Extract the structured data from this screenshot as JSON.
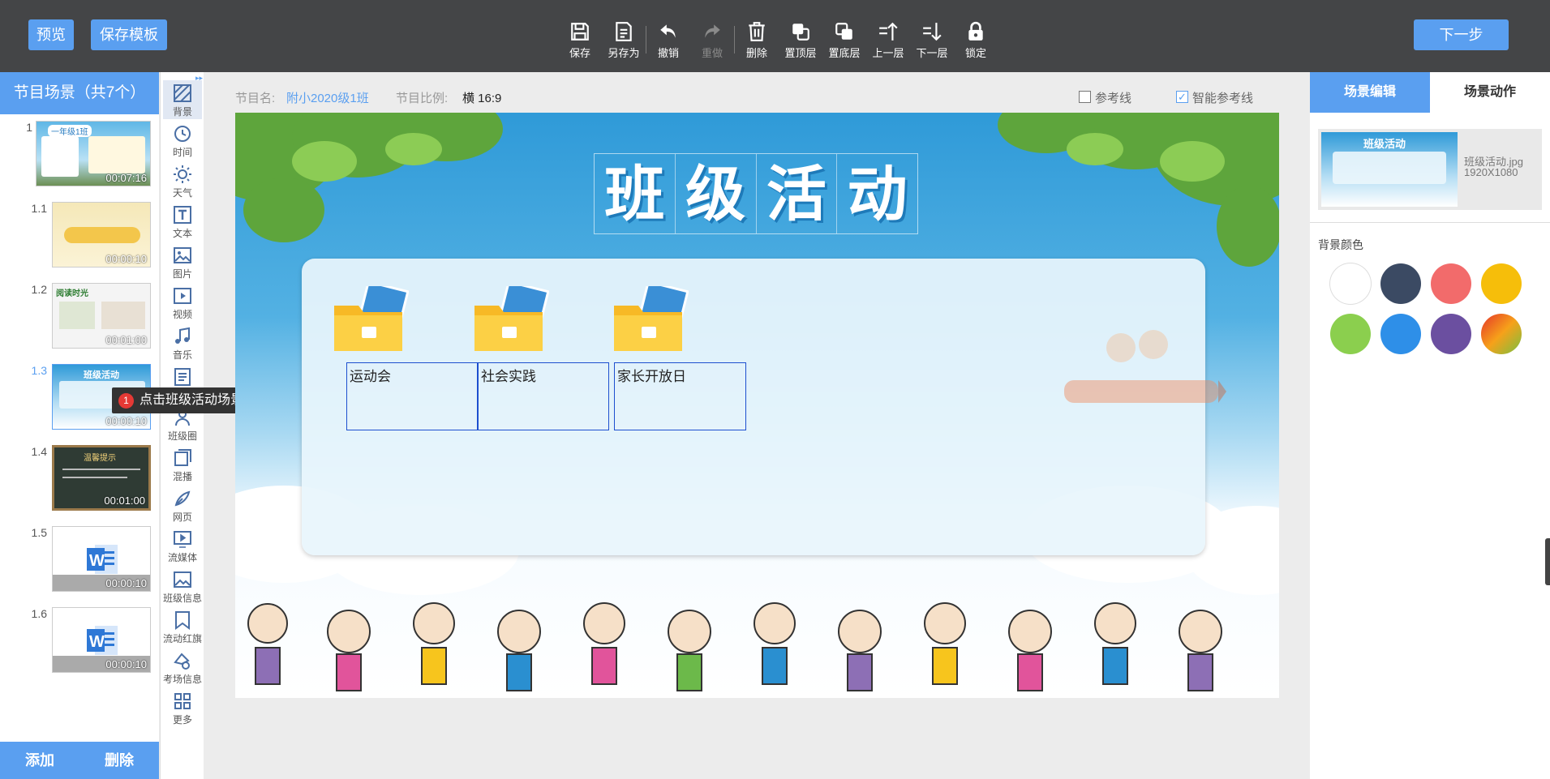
{
  "header": {
    "preview_label": "预览",
    "save_template_label": "保存模板",
    "next_label": "下一步",
    "tools": [
      {
        "label": "保存",
        "icon": "save-icon",
        "enabled": true
      },
      {
        "label": "另存为",
        "icon": "save-as-icon",
        "enabled": true
      },
      {
        "label": "撤销",
        "icon": "undo-icon",
        "enabled": true
      },
      {
        "label": "重做",
        "icon": "redo-icon",
        "enabled": false
      },
      {
        "label": "删除",
        "icon": "trash-icon",
        "enabled": true
      },
      {
        "label": "置顶层",
        "icon": "bring-to-front-icon",
        "enabled": true
      },
      {
        "label": "置底层",
        "icon": "send-to-back-icon",
        "enabled": true
      },
      {
        "label": "上一层",
        "icon": "layer-up-icon",
        "enabled": true
      },
      {
        "label": "下一层",
        "icon": "layer-down-icon",
        "enabled": true
      },
      {
        "label": "锁定",
        "icon": "lock-icon",
        "enabled": true
      }
    ]
  },
  "left_panel": {
    "title": "节目场景（共7个）",
    "scenes": [
      {
        "number": "1",
        "duration": "00:07:16",
        "active": false
      },
      {
        "number": "1.1",
        "duration": "00:00:10",
        "active": false
      },
      {
        "number": "1.2",
        "duration": "00:01:00",
        "active": false
      },
      {
        "number": "1.3",
        "duration": "00:00:10",
        "active": true
      },
      {
        "number": "1.4",
        "duration": "00:01:00",
        "active": false
      },
      {
        "number": "1.5",
        "duration": "00:00:10",
        "active": false
      },
      {
        "number": "1.6",
        "duration": "00:00:10",
        "active": false
      }
    ],
    "add_label": "添加",
    "delete_label": "删除",
    "thumb_texts": {
      "t1": "一年级1班",
      "t2": "阅读时光",
      "t3": "班级活动",
      "t4": "温馨提示"
    }
  },
  "tools_bar": [
    {
      "label": "背景",
      "icon": "background-icon"
    },
    {
      "label": "时间",
      "icon": "clock-icon"
    },
    {
      "label": "天气",
      "icon": "weather-icon"
    },
    {
      "label": "文本",
      "icon": "text-icon"
    },
    {
      "label": "图片",
      "icon": "image-icon"
    },
    {
      "label": "视频",
      "icon": "video-icon"
    },
    {
      "label": "音乐",
      "icon": "music-icon"
    },
    {
      "label": "文档",
      "icon": "document-icon"
    },
    {
      "label": "班级圈",
      "icon": "class-circle-icon"
    },
    {
      "label": "混播",
      "icon": "mixed-play-icon"
    },
    {
      "label": "网页",
      "icon": "webpage-icon"
    },
    {
      "label": "流媒体",
      "icon": "stream-icon"
    },
    {
      "label": "班级信息",
      "icon": "class-info-icon"
    },
    {
      "label": "流动红旗",
      "icon": "red-flag-icon"
    },
    {
      "label": "考场信息",
      "icon": "exam-info-icon"
    },
    {
      "label": "更多",
      "icon": "more-grid-icon"
    }
  ],
  "tooltip": {
    "number": "1",
    "text": "点击班级活动场景"
  },
  "info_bar": {
    "program_name_label": "节目名:",
    "program_name_value": "附小2020级1班",
    "ratio_label": "节目比例:",
    "ratio_value": "横 16:9",
    "guide_label": "参考线",
    "smart_guide_label": "智能参考线",
    "guide_checked": false,
    "smart_guide_checked": true
  },
  "canvas": {
    "title_chars": [
      "班",
      "级",
      "活",
      "动"
    ],
    "folders": [
      "运动会",
      "社会实践",
      "家长开放日"
    ]
  },
  "right_panel": {
    "tab_scene_edit": "场景编辑",
    "tab_scene_action": "场景动作",
    "bg_filename": "班级活动.jpg",
    "bg_size": "1920X1080",
    "bg_color_label": "背景颜色",
    "colors": [
      "#ffffff",
      "#3b4a63",
      "#f26b6b",
      "#f6be0a",
      "#8bcf4e",
      "#2e8fe8",
      "#6b4fa0",
      "gradient-orange-green"
    ]
  },
  "colors": {
    "accent": "#5a9ff0",
    "topbar": "#444547"
  }
}
